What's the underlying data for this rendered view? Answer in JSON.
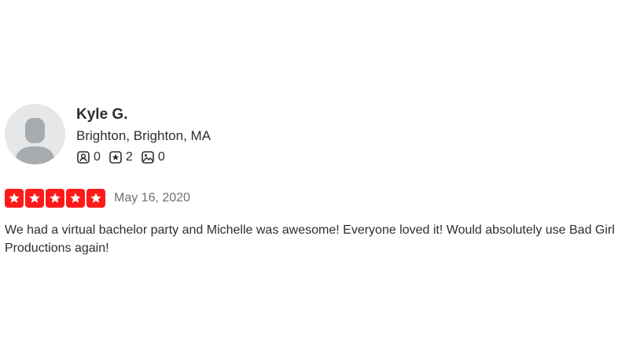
{
  "reviewer": {
    "name": "Kyle G.",
    "location": "Brighton, Brighton, MA",
    "friends_count": "0",
    "reviews_count": "2",
    "photos_count": "0",
    "avatar_icon": "default-user-avatar"
  },
  "review": {
    "rating": 5,
    "rating_max": 5,
    "star_color": "#ff1a1a",
    "date": "May 16, 2020",
    "text": "We had a virtual bachelor party and Michelle was awesome! Everyone loved it! Would absolutely use Bad Girl Productions again!"
  }
}
